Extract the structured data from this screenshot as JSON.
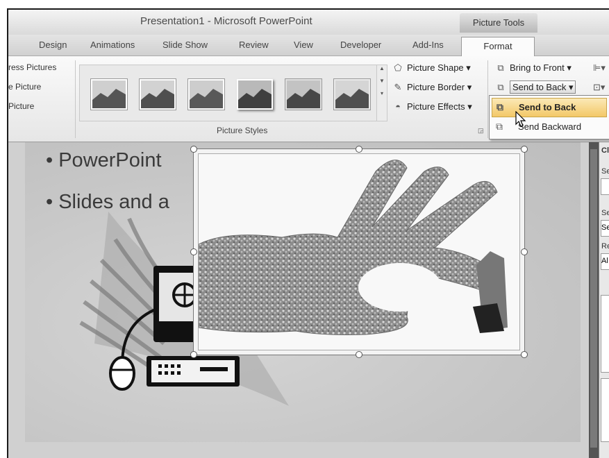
{
  "window": {
    "title": "Presentation1 - Microsoft PowerPoint",
    "contextual_title": "Picture Tools"
  },
  "tabs": [
    "Design",
    "Animations",
    "Slide Show",
    "Review",
    "View",
    "Developer",
    "Add-Ins"
  ],
  "active_tab": "Format",
  "adjust_group": {
    "items": [
      "ress Pictures",
      "e Picture",
      "Picture"
    ]
  },
  "picture_styles": {
    "label": "Picture Styles",
    "commands": [
      "Picture Shape",
      "Picture Border",
      "Picture Effects"
    ]
  },
  "arrange": {
    "bring_to_front": "Bring to Front",
    "send_to_back": "Send to Back"
  },
  "dropdown": {
    "items": [
      "Send to Back",
      "Send Backward"
    ]
  },
  "slide": {
    "bullets": [
      "PowerPoint",
      "Slides and a"
    ]
  },
  "clip_art_pane": {
    "title": "Clip",
    "labels": [
      "Se",
      "Se",
      "Se",
      "Re",
      "Al"
    ]
  },
  "icons": {
    "picture_shape": "picture-shape-icon",
    "picture_border": "picture-border-icon",
    "picture_effects": "picture-effects-icon",
    "bring_to_front": "bring-to-front-icon",
    "send_to_back": "send-to-back-icon",
    "cursor": "mouse-pointer-icon"
  }
}
